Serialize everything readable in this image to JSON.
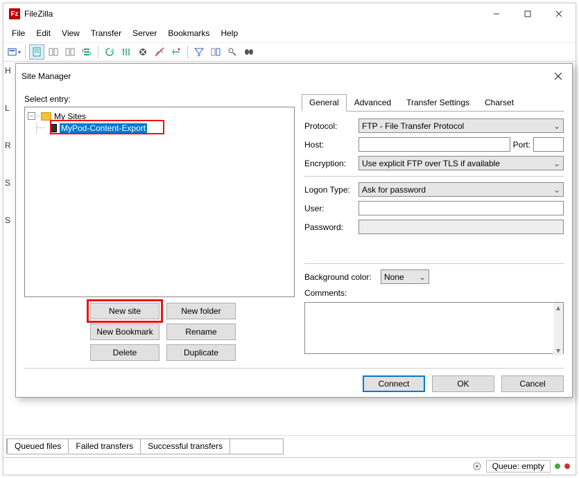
{
  "window": {
    "title": "FileZilla"
  },
  "menu": {
    "file": "File",
    "edit": "Edit",
    "view": "View",
    "transfer": "Transfer",
    "server": "Server",
    "bookmarks": "Bookmarks",
    "help": "Help"
  },
  "dialog": {
    "title": "Site Manager",
    "select_label": "Select entry:",
    "tree": {
      "root": "My Sites",
      "site": "MyPod-Content-Export"
    },
    "buttons": {
      "new_site": "New site",
      "new_folder": "New folder",
      "new_bookmark": "New Bookmark",
      "rename": "Rename",
      "delete": "Delete",
      "duplicate": "Duplicate"
    },
    "tabs": {
      "general": "General",
      "advanced": "Advanced",
      "transfer": "Transfer Settings",
      "charset": "Charset"
    },
    "form": {
      "protocol_label": "Protocol:",
      "protocol_value": "FTP - File Transfer Protocol",
      "host_label": "Host:",
      "host_value": "",
      "port_label": "Port:",
      "port_value": "",
      "encryption_label": "Encryption:",
      "encryption_value": "Use explicit FTP over TLS if available",
      "logon_label": "Logon Type:",
      "logon_value": "Ask for password",
      "user_label": "User:",
      "user_value": "",
      "password_label": "Password:",
      "password_value": "",
      "bgcolor_label": "Background color:",
      "bgcolor_value": "None",
      "comments_label": "Comments:",
      "comments_value": ""
    },
    "footer": {
      "connect": "Connect",
      "ok": "OK",
      "cancel": "Cancel"
    }
  },
  "bottom_tabs": {
    "queued": "Queued files",
    "failed": "Failed transfers",
    "success": "Successful transfers"
  },
  "status": {
    "queue_label": "Queue: empty"
  },
  "side_panel_labels": {
    "h": "H",
    "l": "L",
    "r": "R",
    "s": "S",
    "s2": "S"
  }
}
